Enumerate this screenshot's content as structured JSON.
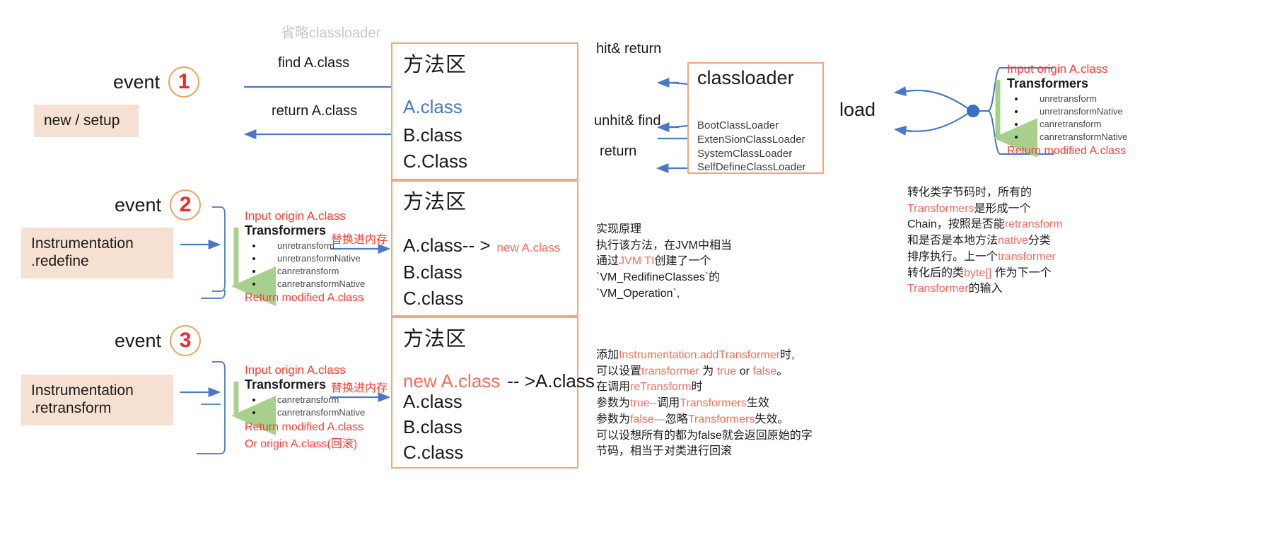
{
  "diagram": {
    "note_top": "省略classloader",
    "events": {
      "label": "event",
      "n1": "1",
      "n2": "2",
      "n3": "3"
    },
    "left_boxes": {
      "box1": "new / setup",
      "box2_line1": "Instrumentation",
      "box2_line2": ".redefine",
      "box3_line1": "Instrumentation",
      "box3_line2": ".retransform"
    },
    "arrows": {
      "find": "find A.class",
      "return_a": "return A.class",
      "hit_return": "hit& return",
      "unhit_find": "unhit& find",
      "return": "return",
      "load": "load",
      "replace_memory_2": "替换进内存",
      "replace_memory_3": "替换进内存"
    },
    "method_area_1": {
      "title": "方法区",
      "items": [
        "A.class",
        "B.class",
        "C.Class"
      ]
    },
    "method_area_2": {
      "title": "方法区",
      "line1_black": "A.class-- >",
      "line1_red": "new A.class",
      "items": [
        "B.class",
        "C.class"
      ]
    },
    "method_area_3": {
      "title": "方法区",
      "line1_red": "new A.class",
      "line1_black": "-- >A.class",
      "items": [
        "A.class",
        "B.class",
        "C.class"
      ]
    },
    "classloader": {
      "title": "classloader",
      "items": [
        "BootClassLoader",
        "ExtenSionClassLoader",
        "SystemClassLoader",
        "SelfDefineClassLoader"
      ]
    },
    "transformers_right": {
      "input": "Input origin A.class",
      "title": "Transformers",
      "items": [
        "unretransform",
        "unretransformNative",
        "canretransform",
        "canretransformNative"
      ],
      "output": "Return modified A.class"
    },
    "transformers_e2": {
      "input": "Input origin A.class",
      "title": "Transformers",
      "items": [
        "unretransform",
        "unretransformNative",
        "canretransform",
        "canretransformNative"
      ],
      "output": "Return modified A.class"
    },
    "transformers_e3": {
      "input": "Input origin A.class",
      "title": "Transformers",
      "items": [
        "canretransform",
        "canretransformNative"
      ],
      "output1": "Return modified A.class",
      "output2": "Or origin A.class(回滚)"
    },
    "note_redefine": {
      "l1": "实现原理",
      "l2": "执行该方法，在JVM中相当",
      "l3a": "通过",
      "l3b": "JVM TI",
      "l3c": "创建了一个",
      "l4": "`VM_RedifineClasses`的",
      "l5": "`VM_Operation`,"
    },
    "note_retransform": {
      "l1a": "添加",
      "l1b": "Instrumentation.addTransformer",
      "l1c": "时,",
      "l2a": "可以设置",
      "l2b": "transformer",
      "l2c": " 为 ",
      "l2d": "true",
      "l2e": " or ",
      "l2f": "false",
      "l2g": "。",
      "l3a": "在调用",
      "l3b": "reTransform",
      "l3c": "时",
      "l4a": "参数为",
      "l4b": "true--",
      "l4c": "调用",
      "l4d": "Transformers",
      "l4e": "生效",
      "l5a": "参数为",
      "l5b": "false—",
      "l5c": "忽略",
      "l5d": "Transformers",
      "l5e": "失效。",
      "l6": "可以设想所有的都为false就会返回原始的字",
      "l7": "节码，相当于对类进行回滚"
    },
    "note_chain": {
      "l1": "转化类字节码时，所有的",
      "l2a": "Transformers",
      "l2b": "是形成一个",
      "l3a": "Chain，按照是否能",
      "l3b": "retransform",
      "l4a": "和是否是本地方法",
      "l4b": "native",
      "l4c": "分类",
      "l5a": "排序执行。上一个",
      "l5b": "transformer",
      "l6a": "转化后的类",
      "l6b": "byte[]",
      "l6c": " 作为下一个",
      "l7a": "Transformer",
      "l7b": "的输入"
    }
  },
  "colors": {
    "accent_orange": "#f0a878",
    "accent_red": "#ff3b30",
    "accent_blue": "#4878c8",
    "peach_bg": "#f6e0d2",
    "green": "#a8d08d",
    "link_blue": "#4a86c8"
  }
}
